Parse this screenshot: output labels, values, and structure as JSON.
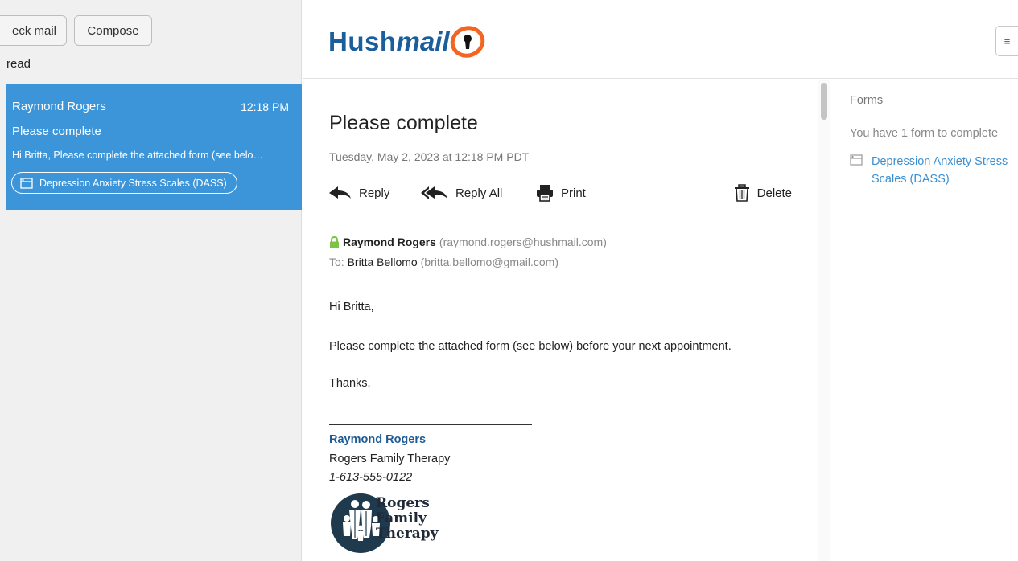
{
  "sidebar": {
    "check_mail_label": "eck mail",
    "compose_label": "Compose",
    "filter_label": "read",
    "messages": [
      {
        "from": "Raymond Rogers",
        "time": "12:18 PM",
        "subject": "Please complete",
        "preview": "Hi Britta, Please complete the attached form (see belo…",
        "attachment": "Depression Anxiety Stress Scales (DASS)"
      }
    ]
  },
  "header": {
    "logo_prefix": "Hush",
    "logo_suffix": "mail",
    "menu_icon": "≡"
  },
  "message": {
    "subject": "Please complete",
    "date": "Tuesday, May 2, 2023 at 12:18 PM PDT",
    "actions": {
      "reply": "Reply",
      "reply_all": "Reply All",
      "print": "Print",
      "delete": "Delete"
    },
    "sender_name": "Raymond Rogers",
    "sender_email": "(raymond.rogers@hushmail.com)",
    "to_label": "To:",
    "to_name": "Britta Bellomo",
    "to_email": "(britta.bellomo@gmail.com)",
    "body": {
      "greeting": "Hi Britta,",
      "paragraph": "Please complete the attached form (see below) before your next appointment.",
      "closing": "Thanks,"
    },
    "signature": {
      "rule": "_______________________________",
      "name": "Raymond Rogers",
      "org": "Rogers Family Therapy",
      "phone": "1-613-555-0122",
      "logo_line1": "Rogers",
      "logo_line2": "Family",
      "logo_line3": "Therapy"
    }
  },
  "forms_panel": {
    "title": "Forms",
    "count_text": "You have 1 form to complete",
    "form_name": "Depression Anxiety Stress Scales (DASS)"
  },
  "colors": {
    "accent": "#3d95d9",
    "logo_blue": "#1b5e9c",
    "logo_orange": "#f26522",
    "link": "#3d8fd0",
    "lock_green": "#7cc243"
  }
}
